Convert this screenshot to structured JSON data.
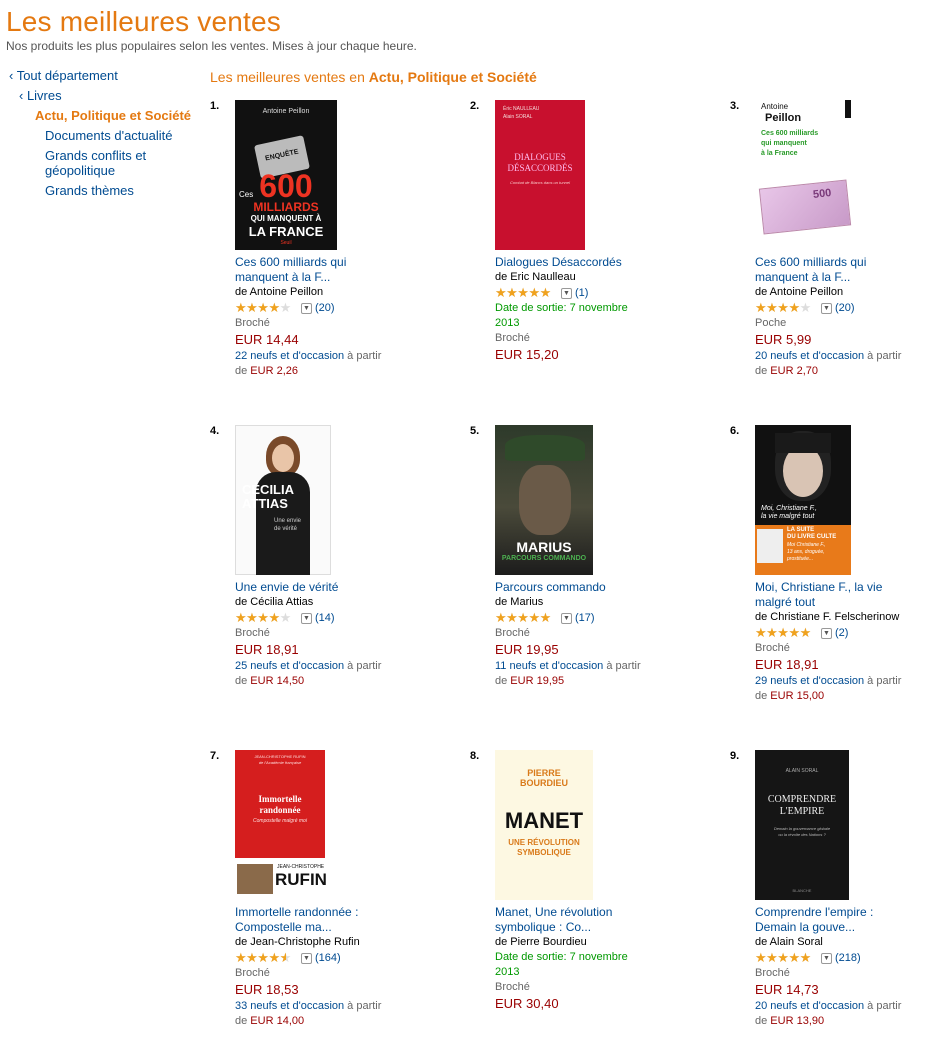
{
  "header": {
    "title": "Les meilleures ventes",
    "subtitle": "Nos produits les plus populaires selon les ventes. Mises à jour chaque heure."
  },
  "sidebar": {
    "items": [
      {
        "label": "‹ Tout département"
      },
      {
        "label": "‹ Livres"
      },
      {
        "label": "Actu, Politique et Société"
      },
      {
        "label": "Documents d'actualité"
      },
      {
        "label": "Grands conflits et"
      },
      {
        "label": "géopolitique"
      },
      {
        "label": "Grands thèmes"
      }
    ]
  },
  "section": {
    "prefix": "Les meilleures ventes en",
    "category": "Actu, Politique et Société"
  },
  "colors": {
    "accent": "#e47911",
    "link": "#004b91",
    "price": "#990000",
    "release": "#009900"
  },
  "products": [
    {
      "rank": "1.",
      "title1": "Ces 600 milliards qui",
      "title2": "manquent à la F...",
      "author": "de Antoine Peillon",
      "rating": 3.5,
      "reviews": "(20)",
      "release1": "",
      "release2": "",
      "format": "Broché",
      "price": "EUR 14,44",
      "offers1": "22 neufs et d'occasion",
      "offers1_suffix": " à partir",
      "offers2_prefix": "de ",
      "offers2_price": "EUR 2,26",
      "cover": {
        "line1": "Antoine Peillon",
        "line2": "ENQUÊTE",
        "line3": "Ces",
        "line4": "600",
        "line5": "MILLIARDS",
        "line6": "QUI MANQUENT À",
        "line7": "LA FRANCE",
        "line8": "Seuil"
      }
    },
    {
      "rank": "2.",
      "title1": "Dialogues Désaccordés",
      "title2": "",
      "author": "de Eric Naulleau",
      "rating": 5,
      "reviews": "(1)",
      "release1": "Date de sortie: 7 novembre",
      "release2": "2013",
      "format": "Broché",
      "price": "EUR 15,20",
      "offers1": "",
      "offers1_suffix": "",
      "offers2_prefix": "",
      "offers2_price": "",
      "cover": {
        "line1": "Éric NAULLEAU",
        "line2": "Alain SORAL",
        "line3": "DIALOGUES",
        "line4": "DÉSACCORDÉS",
        "line5": "Combat de Blancs dans un tunnel"
      }
    },
    {
      "rank": "3.",
      "title1": "Ces 600 milliards qui",
      "title2": "manquent à la F...",
      "author": "de Antoine Peillon",
      "rating": 3.5,
      "reviews": "(20)",
      "release1": "",
      "release2": "",
      "format": "Poche",
      "price": "EUR 5,99",
      "offers1": "20 neufs et d'occasion",
      "offers1_suffix": " à partir",
      "offers2_prefix": "de ",
      "offers2_price": "EUR 2,70",
      "cover": {
        "line1": "Antoine",
        "line2": "Peillon",
        "line3": "Ces 600 milliards",
        "line4": "qui manquent",
        "line5": "à la France",
        "line6": "500"
      }
    },
    {
      "rank": "4.",
      "title1": "Une envie de vérité",
      "title2": "",
      "author": "de Cécilia Attias",
      "rating": 3.5,
      "reviews": "(14)",
      "release1": "",
      "release2": "",
      "format": "Broché",
      "price": "EUR 18,91",
      "offers1": "25 neufs et d'occasion",
      "offers1_suffix": " à partir",
      "offers2_prefix": "de ",
      "offers2_price": "EUR 14,50",
      "cover": {
        "line1": "CÉCILIA",
        "line2": "ATTIAS",
        "line3": "Une envie",
        "line4": "de vérité"
      }
    },
    {
      "rank": "5.",
      "title1": "Parcours commando",
      "title2": "",
      "author": "de Marius",
      "rating": 5,
      "reviews": "(17)",
      "release1": "",
      "release2": "",
      "format": "Broché",
      "price": "EUR 19,95",
      "offers1": "11 neufs et d'occasion",
      "offers1_suffix": " à partir",
      "offers2_prefix": "de ",
      "offers2_price": "EUR 19,95",
      "cover": {
        "line1": "MARIUS",
        "line2": "PARCOURS COMMANDO"
      }
    },
    {
      "rank": "6.",
      "title1": "Moi, Christiane F., la vie",
      "title2": "malgré tout",
      "author": "de Christiane F. Felscherinow",
      "rating": 5,
      "reviews": "(2)",
      "release1": "",
      "release2": "",
      "format": "Broché",
      "price": "EUR 18,91",
      "offers1": "29 neufs et d'occasion",
      "offers1_suffix": " à partir",
      "offers2_prefix": "de ",
      "offers2_price": "EUR 15,00",
      "cover": {
        "line1": "Moi, Christiane F.,",
        "line2": "la vie malgré tout",
        "line3": "LA SUITE",
        "line4": "DU LIVRE CULTE",
        "line5": "Moi Christiane F.,",
        "line6": "13 ans, droguée,",
        "line7": "prostituée..."
      }
    },
    {
      "rank": "7.",
      "title1": "Immortelle randonnée :",
      "title2": "Compostelle ma...",
      "author": "de Jean-Christophe Rufin",
      "rating": 4,
      "reviews": "(164)",
      "release1": "",
      "release2": "",
      "format": "Broché",
      "price": "EUR 18,53",
      "offers1": "33 neufs et d'occasion",
      "offers1_suffix": " à partir",
      "offers2_prefix": "de ",
      "offers2_price": "EUR 14,00",
      "cover": {
        "line1": "JEAN-CHRISTOPHE RUFIN",
        "line2": "de l'Académie française",
        "line3": "Immortelle",
        "line4": "randonnée",
        "line5": "Compostelle malgré moi",
        "line6": "JEAN-CHRISTOPHE",
        "line7": "RUFIN"
      }
    },
    {
      "rank": "8.",
      "title1": "Manet, Une révolution",
      "title2": "symbolique : Co...",
      "author": "de Pierre Bourdieu",
      "rating": 0,
      "reviews": "",
      "release1": "Date de sortie: 7 novembre",
      "release2": "2013",
      "format": "Broché",
      "price": "EUR 30,40",
      "offers1": "",
      "offers1_suffix": "",
      "offers2_prefix": "",
      "offers2_price": "",
      "cover": {
        "line1": "PIERRE",
        "line2": "BOURDIEU",
        "line3": "MANET",
        "line4": "UNE RÉVOLUTION",
        "line5": "SYMBOLIQUE"
      }
    },
    {
      "rank": "9.",
      "title1": "Comprendre l'empire :",
      "title2": "Demain la gouve...",
      "author": "de Alain Soral",
      "rating": 4.5,
      "reviews": "(218)",
      "release1": "",
      "release2": "",
      "format": "Broché",
      "price": "EUR 14,73",
      "offers1": "20 neufs et d'occasion",
      "offers1_suffix": " à partir",
      "offers2_prefix": "de ",
      "offers2_price": "EUR 13,90",
      "cover": {
        "line1": "ALAIN SORAL",
        "line2": "COMPRENDRE",
        "line3": "L'EMPIRE",
        "line4": "Demain la gouvernance globale",
        "line5": "ou la révolte des Nations ?",
        "line6": "BLANCHE"
      }
    }
  ]
}
